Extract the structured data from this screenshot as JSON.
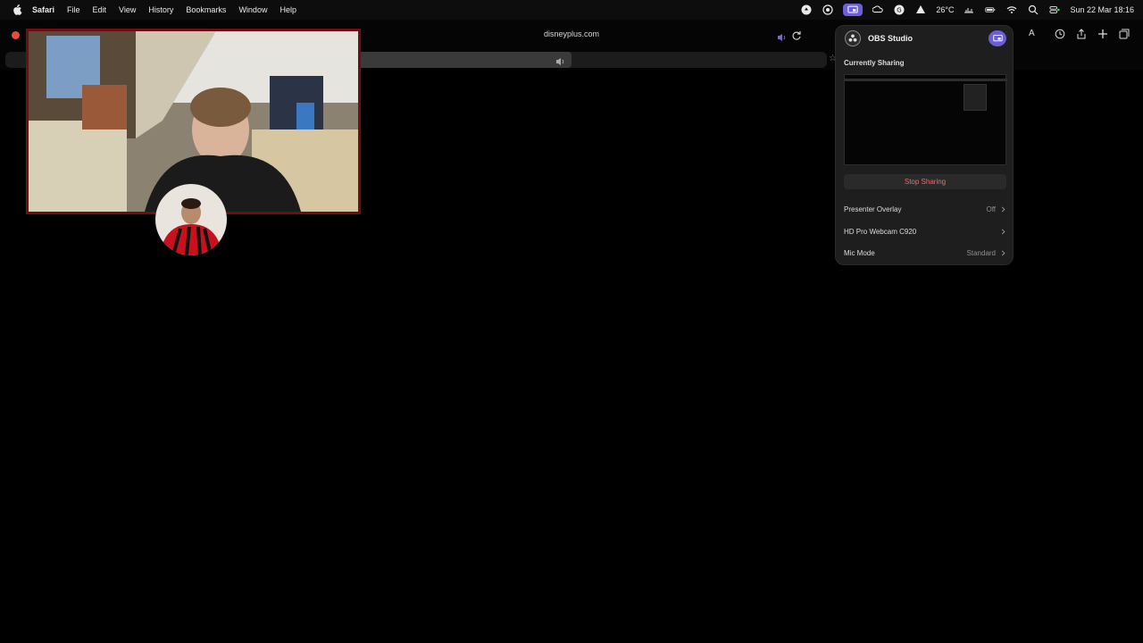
{
  "menubar": {
    "app": "Safari",
    "items": [
      "File",
      "Edit",
      "View",
      "History",
      "Bookmarks",
      "Window",
      "Help"
    ],
    "temperature": "26°C",
    "datetime": "Sun 22 Mar 18:16"
  },
  "browser": {
    "url": "disneyplus.com"
  },
  "obs": {
    "app_name": "OBS Studio",
    "section_label": "Currently Sharing",
    "stop_label": "Stop Sharing",
    "rows": [
      {
        "label": "Presenter Overlay",
        "value": "Off"
      },
      {
        "label": "HD Pro Webcam C920",
        "value": ""
      },
      {
        "label": "Mic Mode",
        "value": "Standard"
      }
    ]
  },
  "colors": {
    "accent": "#6b5fd6",
    "stop_text": "#ef6b6b",
    "webcam_border": "#6e0d14"
  }
}
